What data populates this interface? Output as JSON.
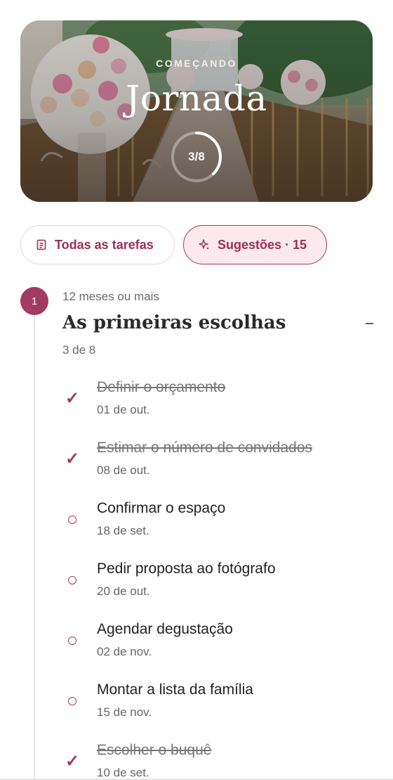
{
  "hero": {
    "eyebrow": "COMEÇANDO",
    "title": "Jornada",
    "progress_label": "3/8",
    "progress_fraction": 0.375
  },
  "filters": {
    "all_tasks": "Todas as tarefas",
    "suggestions": "Sugestões · 15"
  },
  "section": {
    "step_number": "1",
    "period": "12 meses ou mais",
    "title": "As primeiras escolhas",
    "count": "3 de 8"
  },
  "tasks": [
    {
      "name": "Definir o orçamento",
      "date": "01 de out.",
      "done": true
    },
    {
      "name": "Estimar o número de convidados",
      "date": "08 de out.",
      "done": true
    },
    {
      "name": "Confirmar o espaço",
      "date": "18 de set.",
      "done": false
    },
    {
      "name": "Pedir proposta ao fotógrafo",
      "date": "20 de out.",
      "done": false
    },
    {
      "name": "Agendar degustação",
      "date": "02 de nov.",
      "done": false
    },
    {
      "name": "Montar a lista da família",
      "date": "15 de nov.",
      "done": false
    },
    {
      "name": "Escolher o buquê",
      "date": "10 de set.",
      "done": true
    }
  ],
  "colors": {
    "accent": "#a33a62",
    "chip_active_bg": "#fbe9ee",
    "rail": "#f2dfe6"
  },
  "icons": {
    "all_tasks": "checklist-icon",
    "suggestions": "sparkle-icon",
    "done": "check-icon",
    "pending": "circle-icon",
    "collapse": "minus-icon"
  }
}
